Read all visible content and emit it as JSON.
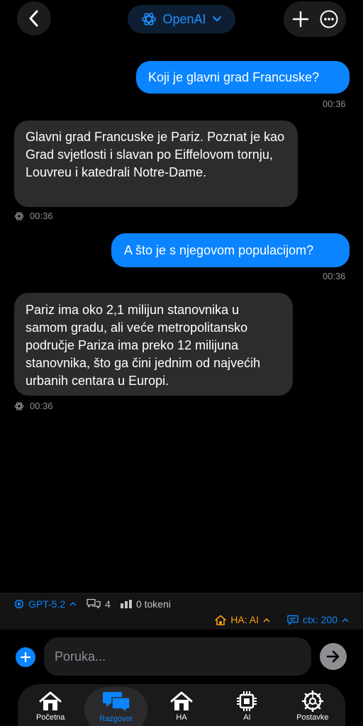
{
  "header": {
    "provider_label": "OpenAI",
    "icons": {
      "back": "chevron-left-icon",
      "provider": "openai-logo-icon",
      "dropdown": "chevron-down-icon",
      "new_chat": "plus-icon",
      "more": "ellipsis-circle-icon"
    }
  },
  "messages": [
    {
      "role": "user",
      "text": "Koji je glavni grad Francuske?",
      "time": "00:36"
    },
    {
      "role": "assistant",
      "text": "Glavni grad Francuske je Pariz. Poznat je kao Grad svjetlosti i slavan po Eiffelovom tornju, Louvreu i katedrali Notre-Dame.",
      "time": "00:36"
    },
    {
      "role": "user",
      "text": "A što je s njegovom populacijom?",
      "time": "00:36"
    },
    {
      "role": "assistant",
      "text": "Pariz ima oko 2,1 milijun stanovnika u samom gradu, ali veće metropolitansko područje Pariza ima preko 12 milijuna stanovnika, što ga čini jednim od najvećih urbanih centara u Europi.",
      "time": "00:36"
    }
  ],
  "status": {
    "model": "GPT-5.2",
    "message_count": "4",
    "tokens": "0 tokeni",
    "ha_mode": "HA: AI",
    "ctx": "ctx: 200"
  },
  "composer": {
    "placeholder": "Poruka..."
  },
  "tabs": [
    {
      "label": "Početna",
      "icon": "home-icon"
    },
    {
      "label": "Razgovor",
      "icon": "chat-bubbles-icon",
      "active": true
    },
    {
      "label": "HA",
      "icon": "home-icon"
    },
    {
      "label": "AI",
      "icon": "chip-icon"
    },
    {
      "label": "Postavke",
      "icon": "gear-icon"
    }
  ],
  "colors": {
    "accent": "#0a84ff",
    "ha_orange": "#ff9f0a",
    "background": "#000000",
    "bubble_ai": "#2c2c2e"
  }
}
